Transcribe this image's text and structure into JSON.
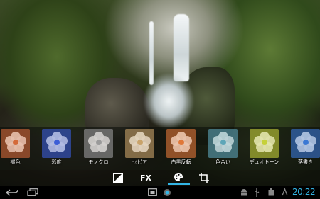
{
  "photo": {
    "subject": "waterfall"
  },
  "filters": [
    {
      "label": "褪色",
      "icon": "flower-thumbnail",
      "tint": "#d46a3a"
    },
    {
      "label": "彩度",
      "icon": "flower-thumbnail",
      "tint": "#3d5fd6"
    },
    {
      "label": "モノクロ",
      "icon": "flower-thumbnail",
      "tint": "#9a9a9a"
    },
    {
      "label": "セピア",
      "icon": "flower-thumbnail",
      "tint": "#c9a36a"
    },
    {
      "label": "白黒反転",
      "icon": "flower-thumbnail",
      "tint": "#e0793a"
    },
    {
      "label": "色合い",
      "icon": "flower-thumbnail",
      "tint": "#5fa6b8"
    },
    {
      "label": "デュオトーン",
      "icon": "flower-thumbnail",
      "tint": "#c7d23a"
    },
    {
      "label": "落書き",
      "icon": "flower-thumbnail",
      "tint": "#3b78d4"
    }
  ],
  "toolbar": {
    "fx_label": "FX",
    "accent": "#33b5e5",
    "buttons": [
      "contrast-icon",
      "fx-label",
      "palette-icon",
      "crop-icon"
    ],
    "active": "palette-icon"
  },
  "system_bar": {
    "time": "20:22",
    "time_color": "#33b5e5",
    "icons": [
      "back-icon",
      "recent-apps-icon",
      "screenshot-icon",
      "app-icon",
      "android-debug-icon",
      "usb-icon",
      "battery-icon",
      "settings-icon"
    ]
  }
}
